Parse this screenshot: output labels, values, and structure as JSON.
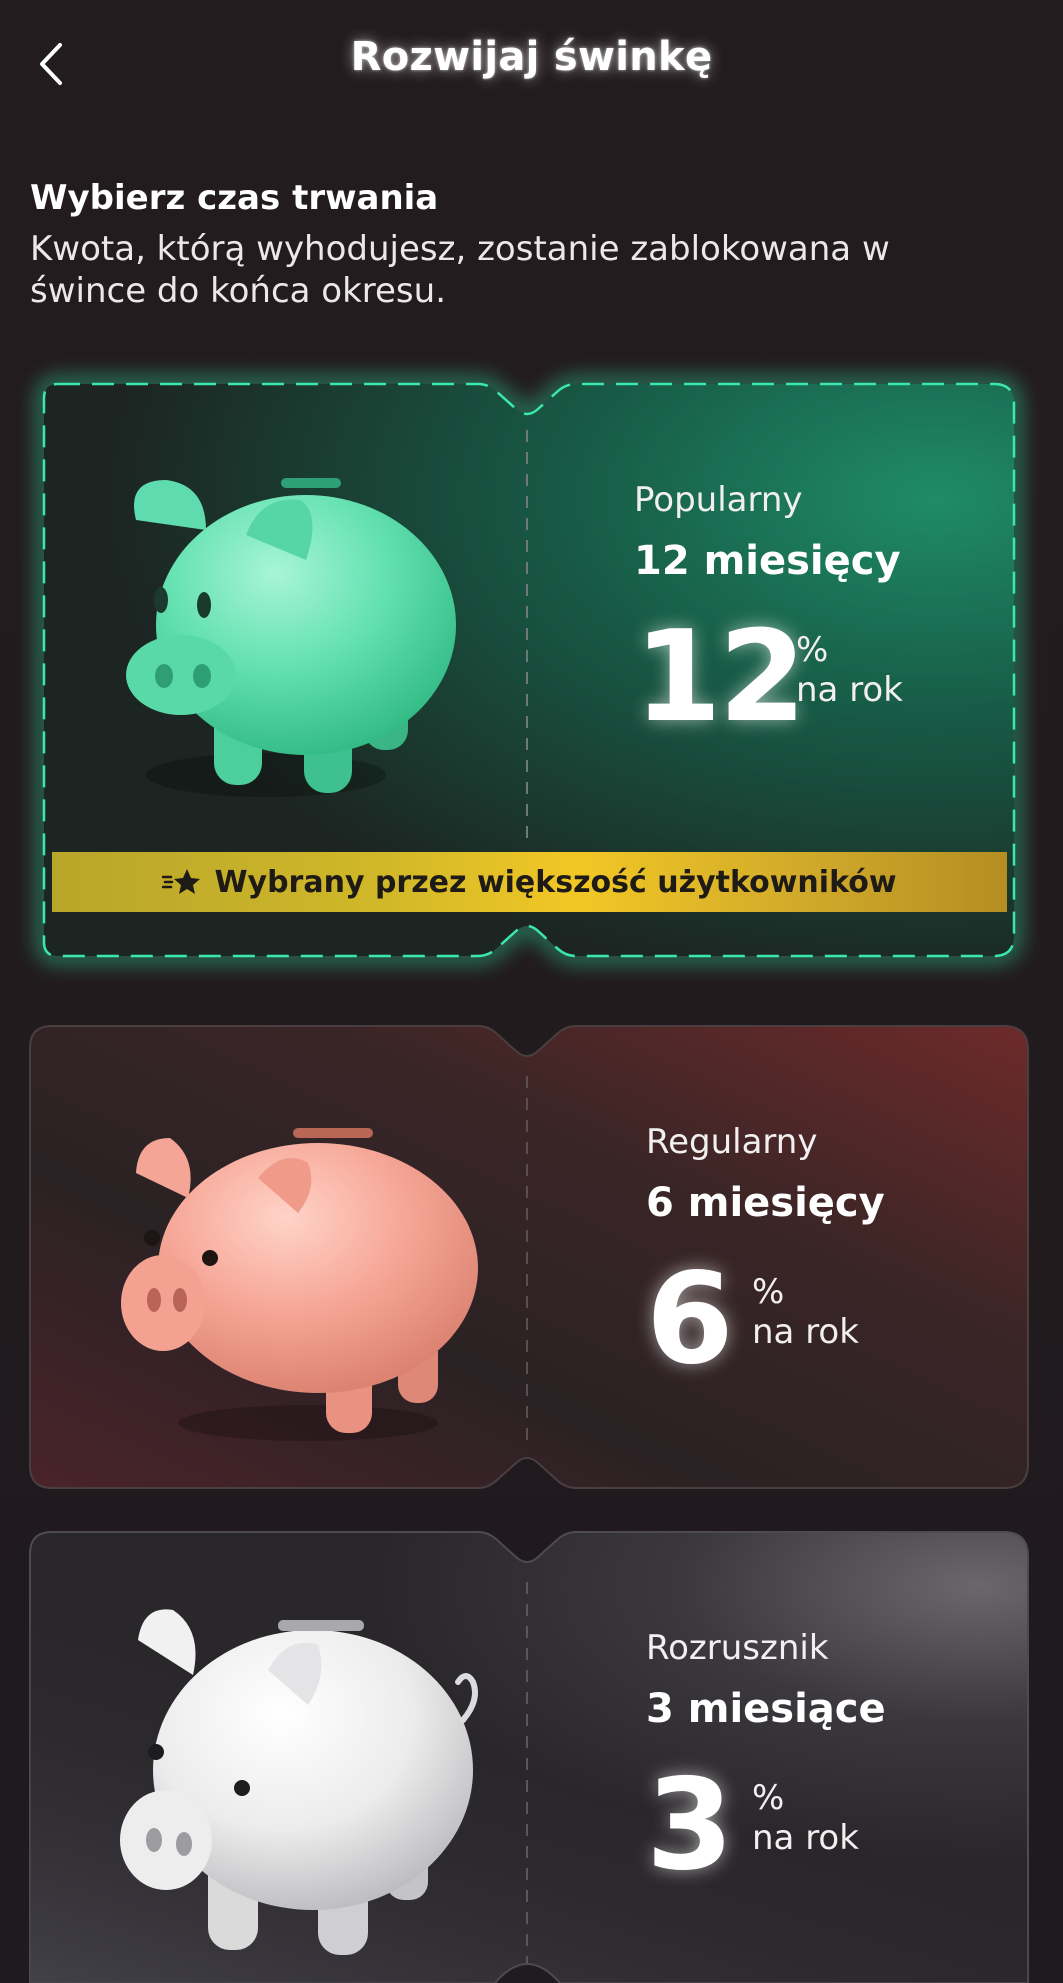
{
  "header": {
    "title": "Rozwijaj świnkę",
    "back_icon": "chevron-left-icon"
  },
  "intro": {
    "title": "Wybierz czas trwania",
    "subtitle_line1": "Kwota, którą wyhodujesz, zostanie zablokowana w",
    "subtitle_line2": "śwince do końca okresu."
  },
  "plans": [
    {
      "name": "Popularny",
      "duration": "12 miesięcy",
      "rate": "12",
      "unit_symbol": "%",
      "unit_text": "na rok",
      "accent": "#2bd9a0",
      "piggy_color": "#6fe3b8",
      "selected": true
    },
    {
      "name": "Regularny",
      "duration": "6 miesięcy",
      "rate": "6",
      "unit_symbol": "%",
      "unit_text": "na rok",
      "accent": "#8a2e2e",
      "piggy_color": "#f6a596",
      "selected": false
    },
    {
      "name": "Rozrusznik",
      "duration": "3 miesiące",
      "rate": "3",
      "unit_symbol": "%",
      "unit_text": "na rok",
      "accent": "#7a7880",
      "piggy_color": "#ececec",
      "selected": false
    }
  ],
  "popular_banner": {
    "text": "Wybrany przez większość użytkowników",
    "icon": "star-sparkle-icon",
    "color": "#e9c12a"
  }
}
